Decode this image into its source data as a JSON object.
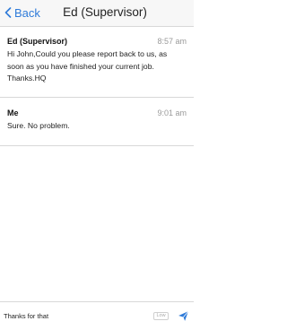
{
  "nav": {
    "back_label": "Back",
    "title": "Ed (Supervisor)"
  },
  "messages": [
    {
      "sender": "Ed (Supervisor)",
      "time": "8:57 am",
      "lines": [
        "Hi John,Could you please report back to us, as",
        "soon as you have finished your current job.",
        "Thanks.HQ"
      ]
    },
    {
      "sender": "Me",
      "time": "9:01 am",
      "lines": [
        "Sure. No problem."
      ]
    }
  ],
  "composer": {
    "value": "Thanks for that",
    "priority_label": "Low"
  },
  "colors": {
    "accent": "#2f7bd9",
    "separator": "#d8d8d8",
    "timestamp": "#9a9a9a"
  }
}
